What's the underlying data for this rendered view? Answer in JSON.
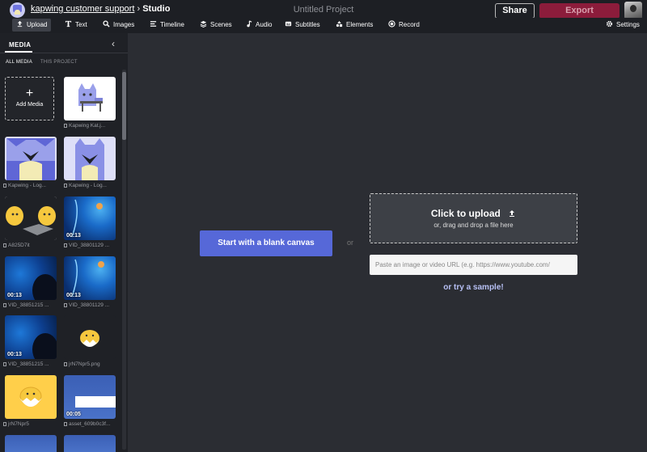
{
  "header": {
    "workspace": "kapwing customer support",
    "separator": "›",
    "section": "Studio",
    "project_title": "Untitled Project",
    "share_label": "Share",
    "export_label": "Export"
  },
  "toolbar": {
    "items": [
      {
        "label": "Upload",
        "icon": "upload-icon",
        "active": true
      },
      {
        "label": "Text",
        "icon": "text-icon"
      },
      {
        "label": "Images",
        "icon": "search-icon"
      },
      {
        "label": "Timeline",
        "icon": "timeline-icon"
      },
      {
        "label": "Scenes",
        "icon": "layers-icon"
      },
      {
        "label": "Audio",
        "icon": "music-note-icon"
      },
      {
        "label": "Subtitles",
        "icon": "subtitles-icon"
      },
      {
        "label": "Elements",
        "icon": "shapes-icon"
      },
      {
        "label": "Record",
        "icon": "record-icon"
      }
    ],
    "settings_label": "Settings"
  },
  "sidebar": {
    "tab": "MEDIA",
    "subtabs": [
      "ALL MEDIA",
      "THIS PROJECT"
    ],
    "add_media_label": "Add Media",
    "items": [
      {
        "name": "Kapwing Kat.j...",
        "duration": ""
      },
      {
        "name": "Kapwing - Log...",
        "duration": ""
      },
      {
        "name": "Kapwing - Log...",
        "duration": ""
      },
      {
        "name": "A825D7it",
        "duration": ""
      },
      {
        "name": "VID_38801129 ...",
        "duration": "00:13"
      },
      {
        "name": "VID_38851215 ...",
        "duration": "00:13"
      },
      {
        "name": "VID_38801129 ...",
        "duration": "00:13"
      },
      {
        "name": "VID_38851215 ...",
        "duration": "00:13"
      },
      {
        "name": "jrN7Npr5.png",
        "duration": ""
      },
      {
        "name": "jrN7Npr5",
        "duration": ""
      },
      {
        "name": "asset_609b0c3f...",
        "duration": "00:05"
      }
    ]
  },
  "main": {
    "blank_canvas_label": "Start with a blank canvas",
    "or_label": "or",
    "upload_title": "Click to upload",
    "upload_sub": "or, drag and drop a file here",
    "url_placeholder": "Paste an image or video URL (e.g. https://www.youtube.com/",
    "sample_label": "or try a sample!"
  },
  "colors": {
    "accent": "#5668d8",
    "export": "#8c1c3b",
    "background": "#2b2d33",
    "panel": "#1f2126"
  }
}
